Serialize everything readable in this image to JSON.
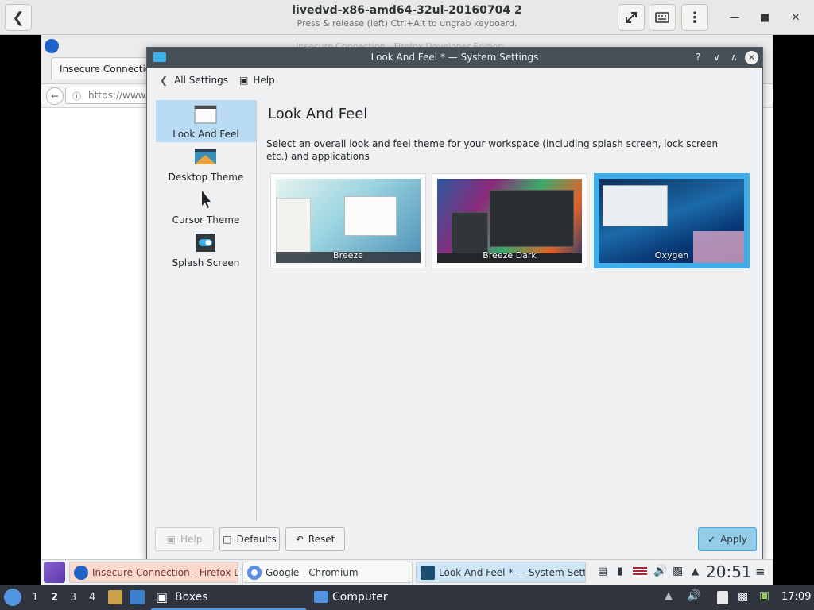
{
  "boxes": {
    "vm_title": "livedvd-x86-amd64-32ul-20160704 2",
    "vm_subtitle": "Press & release (left) Ctrl+Alt to ungrab keyboard."
  },
  "firefox": {
    "window_title_faded": "Insecure Connection - Firefox Developer Edition",
    "tab_label": "Insecure Connection",
    "url": "https://www."
  },
  "settings": {
    "window_title": "Look And Feel * — System Settings",
    "toolbar": {
      "back_label": "All Settings",
      "help_label": "Help"
    },
    "sidebar": [
      {
        "label": "Look And Feel",
        "icon": "window-icon",
        "selected": true
      },
      {
        "label": "Desktop Theme",
        "icon": "desktop-theme-icon",
        "selected": false
      },
      {
        "label": "Cursor Theme",
        "icon": "cursor-icon",
        "selected": false
      },
      {
        "label": "Splash Screen",
        "icon": "splash-toggle-icon",
        "selected": false
      }
    ],
    "page_title": "Look And Feel",
    "description": "Select an overall look and feel theme for your workspace (including splash screen, lock screen etc.) and applications",
    "themes": [
      {
        "label": "Breeze",
        "selected": false
      },
      {
        "label": "Breeze Dark",
        "selected": false
      },
      {
        "label": "Oxygen",
        "selected": true
      }
    ],
    "buttons": {
      "help": "Help",
      "defaults": "Defaults",
      "reset": "Reset",
      "apply": "Apply"
    }
  },
  "vm_panel": {
    "tasks": [
      {
        "label": "Insecure Connection - Firefox De"
      },
      {
        "label": "Google - Chromium"
      },
      {
        "label": "Look And Feel * — System Settin"
      }
    ],
    "clock": "20:51"
  },
  "host_panel": {
    "workspaces": [
      "1",
      "2",
      "3",
      "4"
    ],
    "current_workspace": "2",
    "boxes_label": "Boxes",
    "computer_label": "Computer",
    "time": "17:09"
  },
  "colors": {
    "accent": "#3daee9",
    "titlebar": "#475057",
    "host_panel": "#2f343f"
  }
}
